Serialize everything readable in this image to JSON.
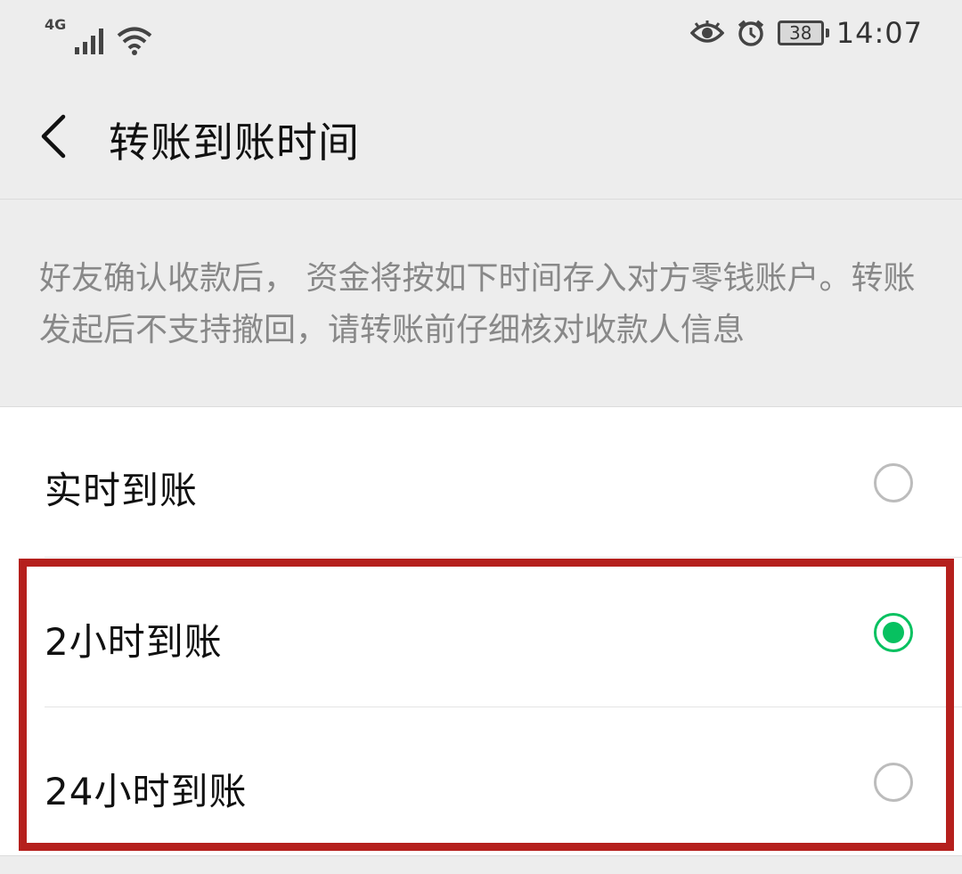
{
  "status_bar": {
    "network": "4G",
    "battery": "38",
    "time": "14:07",
    "icons": [
      "signal-icon",
      "wifi-icon",
      "eye-icon",
      "alarm-icon",
      "battery-icon"
    ]
  },
  "header": {
    "back_icon": "chevron-left-icon",
    "title": "转账到账时间"
  },
  "description": "好友确认收款后， 资金将按如下时间存入对方零钱账户。转账发起后不支持撤回，请转账前仔细核对收款人信息",
  "options": [
    {
      "label": "实时到账",
      "selected": false
    },
    {
      "label": "2小时到账",
      "selected": true
    },
    {
      "label": "24小时到账",
      "selected": false
    }
  ],
  "colors": {
    "accent": "#07c160",
    "highlight": "#b5201d",
    "background": "#ededed"
  }
}
